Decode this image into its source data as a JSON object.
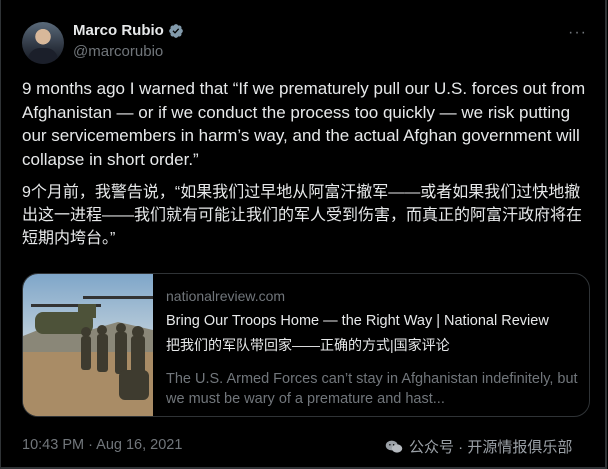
{
  "author": {
    "name": "Marco Rubio",
    "handle": "@marcorubio"
  },
  "more_label": "···",
  "tweet": {
    "text_en": "9 months ago I warned that “If we prematurely pull our U.S. forces out from Afghanistan — or if we conduct the process too quickly — we risk putting our servicemembers in harm’s way, and the actual Afghan government will collapse in short order.”",
    "text_cn": "9个月前，我警告说，“如果我们过早地从阿富汗撤军——或者如果我们过快地撤出这一进程——我们就有可能让我们的军人受到伤害，而真正的阿富汗政府将在短期内垮台。”"
  },
  "card": {
    "domain": "nationalreview.com",
    "title": "Bring Our Troops Home — the Right Way | National Review",
    "title_cn": "把我们的军队带回家——正确的方式|国家评论",
    "description": "The U.S. Armed Forces can’t stay in Afghanistan indefinitely, but we must be wary of a premature and hast..."
  },
  "meta": {
    "timestamp": "10:43 PM · Aug 16, 2021"
  },
  "watermark": {
    "text": "公众号 · 开源情报俱乐部"
  },
  "colors": {
    "background": "#000000",
    "text": "#e7e9ea",
    "secondary": "#71767b",
    "verified": "#829aab",
    "border": "#2f3336"
  }
}
